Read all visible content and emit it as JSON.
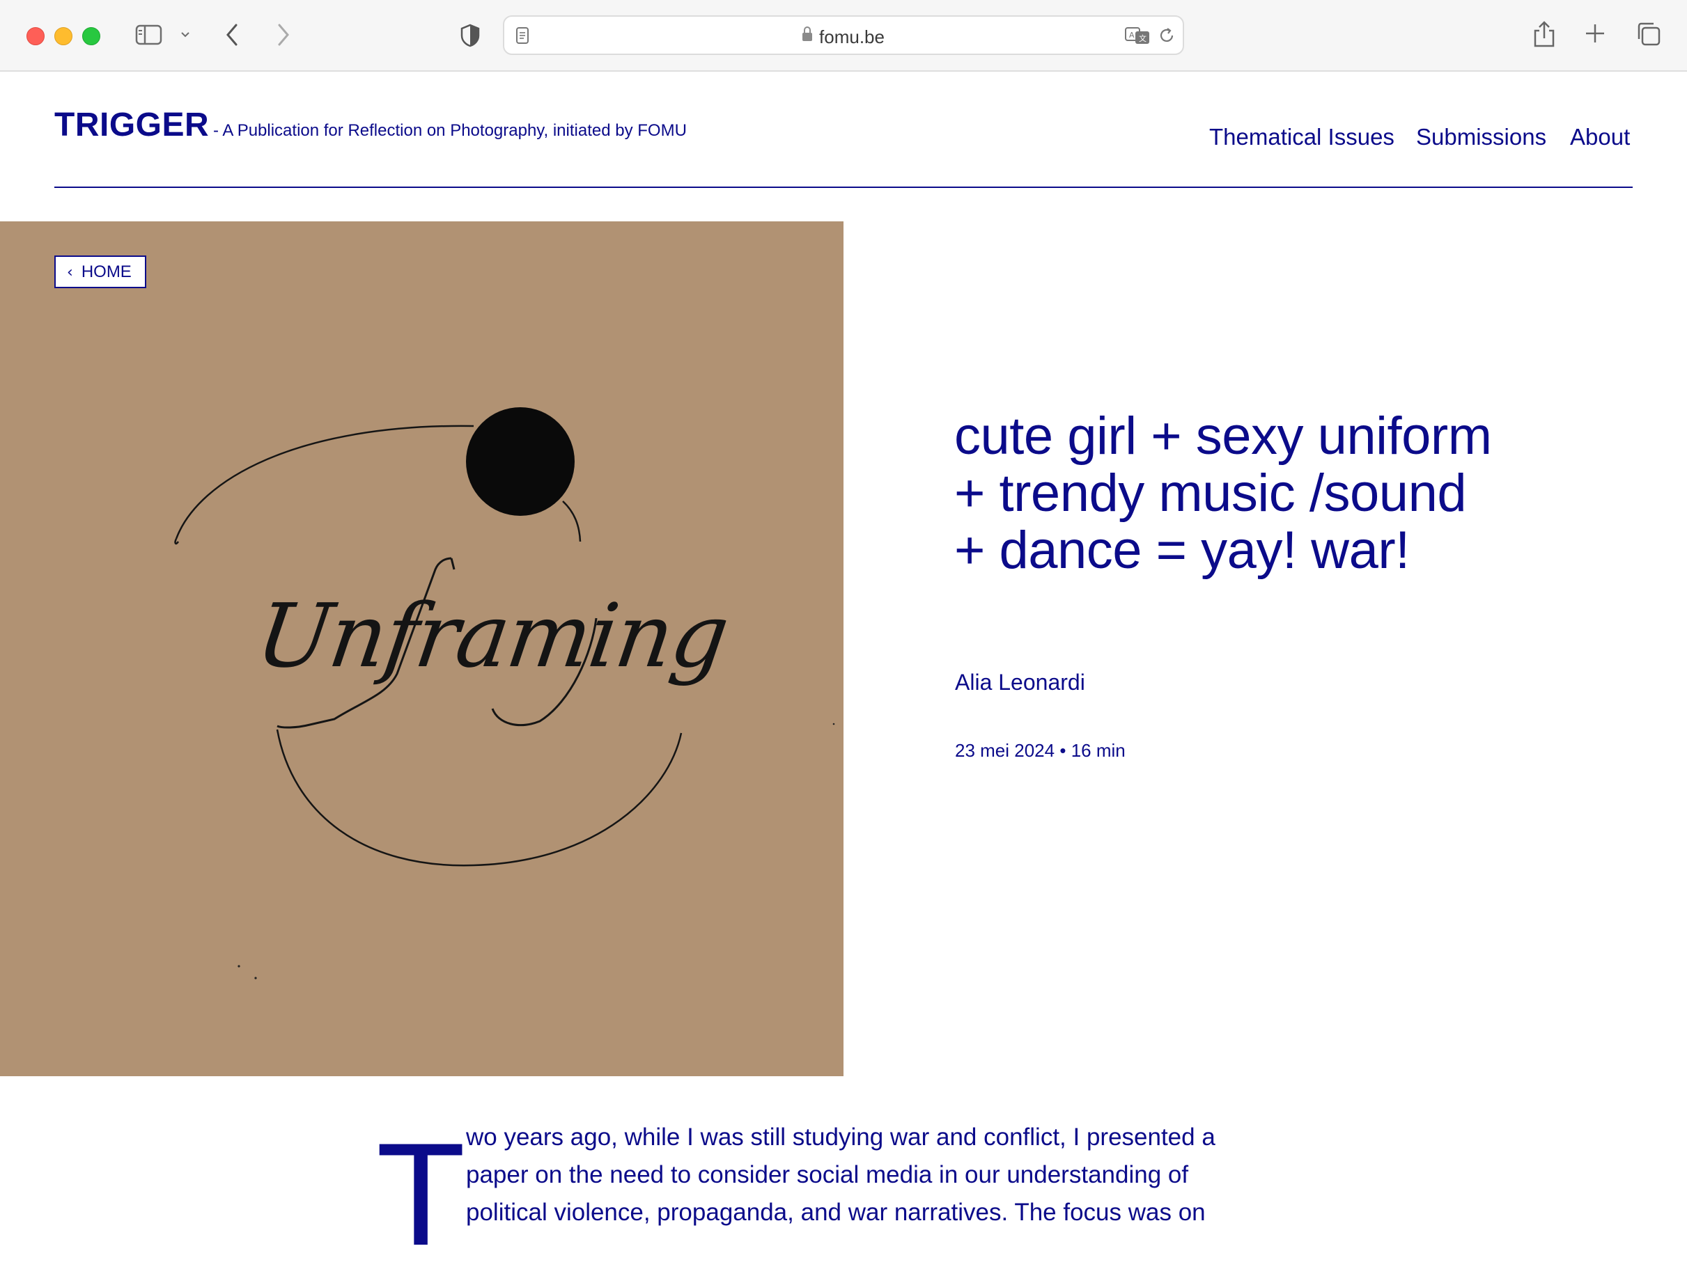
{
  "browser": {
    "url": "fomu.be"
  },
  "site": {
    "brand": "TRIGGER",
    "tagline": "- A Publication for Reflection on Photography, initiated by FOMU",
    "nav": [
      "Thematical Issues",
      "Submissions",
      "About"
    ]
  },
  "hero": {
    "home_label": "HOME",
    "artwork_text": "Unframing",
    "background_color": "#b19273"
  },
  "article": {
    "title_lines": [
      "cute girl + sexy uniform",
      "+ trendy music /sound",
      "+ dance = yay! war!"
    ],
    "author": "Alia Leonardi",
    "date": "23 mei 2024",
    "separator": "•",
    "read_time": "16 min",
    "drop_cap": "T",
    "body_lines": [
      "wo years ago, while I was still studying war and conflict, I presented a",
      "paper on the need to consider social media in our understanding of",
      "political violence, propaganda, and war narratives. The focus was on"
    ]
  },
  "colors": {
    "accent": "#0b0b8a",
    "page_bg": "#ffffff",
    "chrome_bg": "#f6f6f6"
  }
}
